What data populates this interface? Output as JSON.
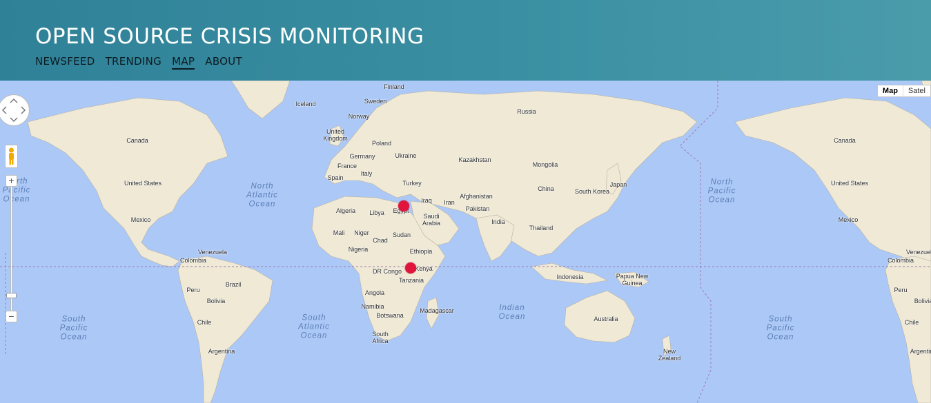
{
  "header": {
    "title": "OPEN SOURCE CRISIS MONITORING",
    "nav": [
      {
        "label": "NEWSFEED",
        "active": false
      },
      {
        "label": "TRENDING",
        "active": false
      },
      {
        "label": "MAP",
        "active": true
      },
      {
        "label": "ABOUT",
        "active": false
      }
    ]
  },
  "map": {
    "map_types": [
      "Map",
      "Satel"
    ],
    "selected_map_type": "Map",
    "zoom_in_label": "+",
    "zoom_out_label": "−",
    "marker_color": "#e0143c",
    "land_color": "#efe9d6",
    "water_color": "#abc8f7",
    "markers": [
      {
        "name": "marker-egypt"
      },
      {
        "name": "marker-kenya"
      }
    ],
    "ocean_labels": [
      "North\nPacific\nOcean",
      "North\nAtlantic\nOcean",
      "North\nPacific\nOcean",
      "South\nPacific\nOcean",
      "South\nAtlantic\nOcean",
      "Indian\nOcean",
      "South\nPacific\nOcean"
    ],
    "country_labels": [
      "Finland",
      "Sweden",
      "Iceland",
      "Norway",
      "United\nKingdom",
      "Poland",
      "Germany",
      "Ukraine",
      "France",
      "Italy",
      "Spain",
      "Turkey",
      "Kazakhstan",
      "Mongolia",
      "Russia",
      "China",
      "South Korea",
      "Japan",
      "Afghanistan",
      "Pakistan",
      "Iraq",
      "Iran",
      "India",
      "Thailand",
      "Saudi\nArabia",
      "Egypt",
      "Algeria",
      "Libya",
      "Mali",
      "Niger",
      "Chad",
      "Sudan",
      "Nigeria",
      "Ethiopia",
      "Kenya",
      "DR Congo",
      "Tanzania",
      "Angola",
      "Namibia",
      "Botswana",
      "South\nAfrica",
      "Madagascar",
      "Indonesia",
      "Papua New\nGuinea",
      "Australia",
      "New\nZealand",
      "Canada",
      "United States",
      "Mexico",
      "Venezuela",
      "Colombia",
      "Peru",
      "Brazil",
      "Bolivia",
      "Chile",
      "Argentina",
      "Canada",
      "United States",
      "Mexico",
      "Venezuela",
      "Colombia",
      "Peru",
      "Bolivia",
      "Chile",
      "Argentina"
    ]
  }
}
